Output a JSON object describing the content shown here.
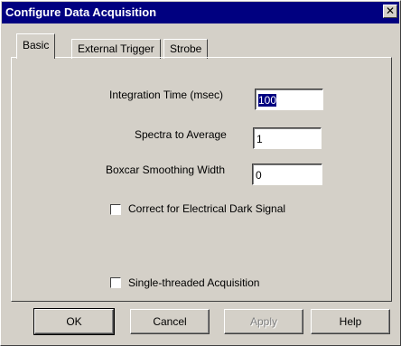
{
  "window": {
    "title": "Configure Data Acquisition",
    "close_glyph": "✕"
  },
  "tabs": [
    "Basic",
    "External Trigger",
    "Strobe"
  ],
  "fields": {
    "integration_time": {
      "label": "Integration Time (msec)",
      "value": "100"
    },
    "spectra_to_average": {
      "label": "Spectra to Average",
      "value": "1"
    },
    "boxcar_smoothing": {
      "label": "Boxcar Smoothing Width",
      "value": "0"
    }
  },
  "checkboxes": {
    "correct_dark": {
      "label": "Correct for Electrical Dark Signal",
      "checked": false
    },
    "single_threaded": {
      "label": "Single-threaded Acquisition",
      "checked": false
    }
  },
  "buttons": {
    "ok": "OK",
    "cancel": "Cancel",
    "apply": "Apply",
    "help": "Help"
  }
}
